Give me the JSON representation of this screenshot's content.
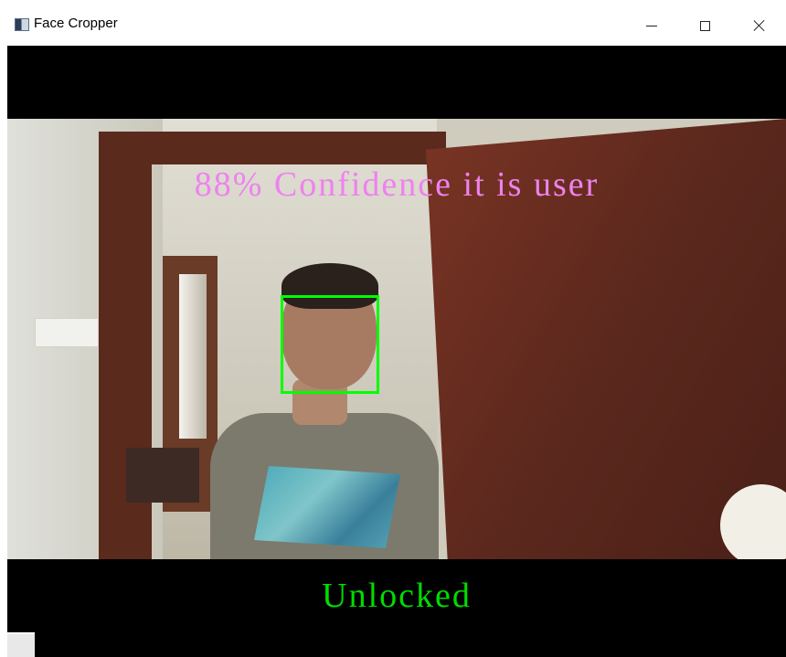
{
  "window": {
    "title": "Face Cropper",
    "icon": "app-window-icon",
    "controls": {
      "minimize": "minimize-icon",
      "maximize": "maximize-icon",
      "close": "close-icon"
    }
  },
  "camera": {
    "confidence_text": "88% Confidence it is user",
    "confidence_color": "#ee82ee",
    "face_box_color": "#00ff00",
    "status_text": "Unlocked",
    "status_color": "#00dd00"
  }
}
